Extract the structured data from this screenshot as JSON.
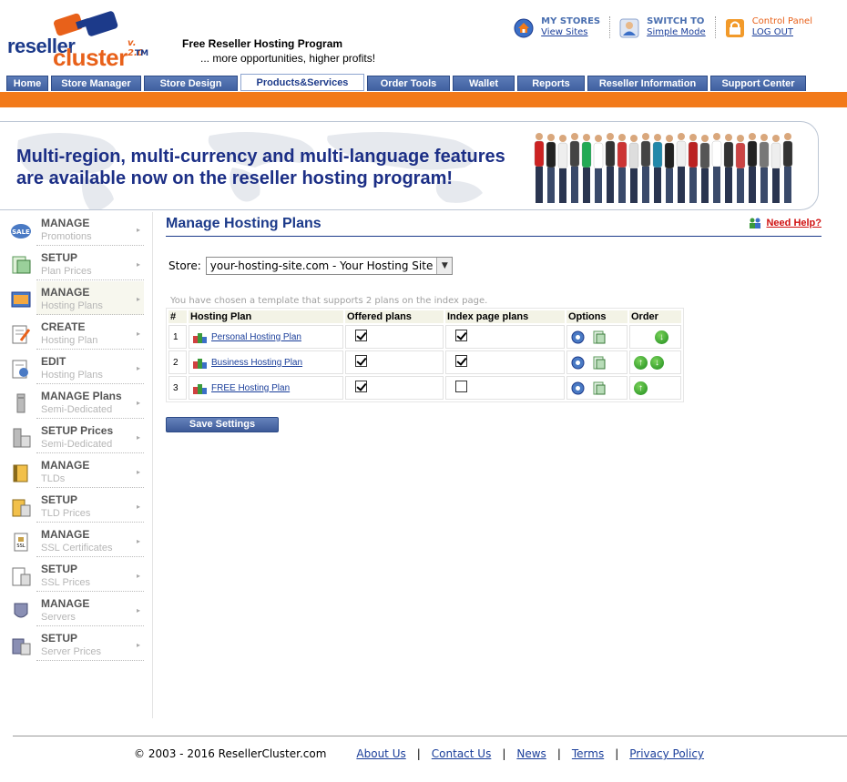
{
  "header": {
    "logo_word1": "reseller",
    "logo_word2": "cluster",
    "logo_tm": "TM",
    "logo_version": "v. 2.0",
    "tagline_title": "Free Reseller Hosting Program",
    "tagline_sub": "... more opportunities, higher profits!",
    "links": [
      {
        "label": "MY STORES",
        "link": "View Sites",
        "icon": "house-icon"
      },
      {
        "label": "SWITCH TO",
        "link": "Simple Mode",
        "icon": "user-switch-icon"
      },
      {
        "label": "Control Panel",
        "link": "LOG OUT",
        "icon": "lock-icon"
      }
    ]
  },
  "nav": {
    "tabs": [
      {
        "label": "Home",
        "active": false
      },
      {
        "label": "Store Manager",
        "active": false
      },
      {
        "label": "Store Design",
        "active": false
      },
      {
        "label": "Products&Services",
        "active": true
      },
      {
        "label": "Order Tools",
        "active": false
      },
      {
        "label": "Wallet",
        "active": false
      },
      {
        "label": "Reports",
        "active": false
      },
      {
        "label": "Reseller Information",
        "active": false
      },
      {
        "label": "Support Center",
        "active": false
      }
    ]
  },
  "banner": {
    "line1": "Multi-region, multi-currency and multi-language features",
    "line2": "are available now on the reseller hosting program!"
  },
  "sidebar": {
    "items": [
      {
        "title": "MANAGE",
        "sub": "Promotions",
        "icon": "sale-icon"
      },
      {
        "title": "SETUP",
        "sub": "Plan Prices",
        "icon": "price-list-icon"
      },
      {
        "title": "MANAGE",
        "sub": "Hosting Plans",
        "icon": "hosting-plans-icon"
      },
      {
        "title": "CREATE",
        "sub": "Hosting Plan",
        "icon": "create-document-icon"
      },
      {
        "title": "EDIT",
        "sub": "Hosting Plans",
        "icon": "edit-document-icon"
      },
      {
        "title": "MANAGE Plans",
        "sub": "Semi-Dedicated",
        "icon": "server-tower-icon"
      },
      {
        "title": "SETUP Prices",
        "sub": "Semi-Dedicated",
        "icon": "server-prices-icon"
      },
      {
        "title": "MANAGE",
        "sub": "TLDs",
        "icon": "tld-book-icon"
      },
      {
        "title": "SETUP",
        "sub": "TLD Prices",
        "icon": "tld-prices-icon"
      },
      {
        "title": "MANAGE",
        "sub": "SSL Certificates",
        "icon": "ssl-lock-icon"
      },
      {
        "title": "SETUP",
        "sub": "SSL Prices",
        "icon": "ssl-calculator-icon"
      },
      {
        "title": "MANAGE",
        "sub": "Servers",
        "icon": "server-shield-icon"
      },
      {
        "title": "SETUP",
        "sub": "Server Prices",
        "icon": "server-price-icon"
      }
    ]
  },
  "main": {
    "title": "Manage Hosting Plans",
    "help": "Need Help?",
    "store_label": "Store:",
    "store_value": "your-hosting-site.com - Your Hosting Site",
    "note": "You have chosen a template that supports 2 plans on the index page.",
    "columns": [
      "#",
      "Hosting Plan",
      "Offered plans",
      "Index page plans",
      "Options",
      "Order"
    ],
    "rows": [
      {
        "num": "1",
        "plan": "Personal Hosting Plan",
        "offered": true,
        "index": true,
        "up": false,
        "down": true
      },
      {
        "num": "2",
        "plan": "Business Hosting Plan",
        "offered": true,
        "index": true,
        "up": true,
        "down": true
      },
      {
        "num": "3",
        "plan": "FREE Hosting Plan",
        "offered": true,
        "index": false,
        "up": true,
        "down": false
      }
    ],
    "save_label": "Save Settings"
  },
  "footer": {
    "copyright": "© 2003 - 2016 ResellerCluster.com",
    "links": [
      "About Us",
      "Contact Us",
      "News",
      "Terms",
      "Privacy Policy"
    ],
    "separator": "|"
  }
}
